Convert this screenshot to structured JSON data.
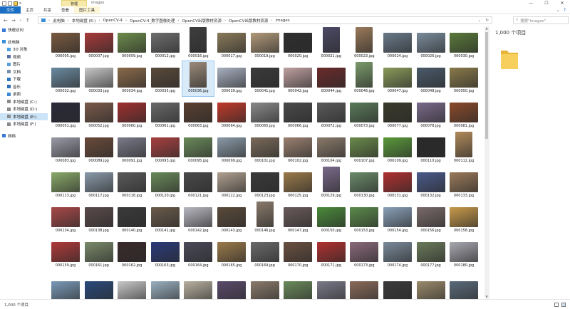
{
  "window": {
    "context_tab": "管理",
    "title": "images",
    "controls": [
      "—",
      "☐",
      "✕"
    ]
  },
  "ribbon": {
    "tabs": [
      "文件",
      "主页",
      "共享",
      "查看",
      "图片工具"
    ]
  },
  "address": {
    "crumbs": [
      "此电脑",
      "本地磁盘 (E:)",
      "OpenCV-4",
      "OpenCV-4_数字图像处理",
      "OpenCV出版教材资源",
      "OpenCV出版教材资源",
      "images"
    ],
    "search_placeholder": "搜索\"images\""
  },
  "nav": {
    "items": [
      {
        "label": "快速访问",
        "level": 1,
        "icon": "star-icon",
        "color": "#3a7bd5"
      },
      {
        "gap": true
      },
      {
        "label": "此电脑",
        "level": 1,
        "icon": "computer-icon",
        "color": "#3a8fd8"
      },
      {
        "label": "3D 对象",
        "level": 2,
        "icon": "cube-icon",
        "color": "#4aa3df"
      },
      {
        "label": "视频",
        "level": 2,
        "icon": "video-icon",
        "color": "#5b6ea8"
      },
      {
        "label": "图片",
        "level": 2,
        "icon": "picture-icon",
        "color": "#5aa0d8"
      },
      {
        "label": "文档",
        "level": 2,
        "icon": "document-icon",
        "color": "#7a8fa8"
      },
      {
        "label": "下载",
        "level": 2,
        "icon": "download-icon",
        "color": "#2f78c4"
      },
      {
        "label": "音乐",
        "level": 2,
        "icon": "music-icon",
        "color": "#2f6fb8"
      },
      {
        "label": "桌面",
        "level": 2,
        "icon": "desktop-icon",
        "color": "#3c8ad6"
      },
      {
        "label": "本地磁盘 (C:)",
        "level": 2,
        "icon": "drive-icon",
        "color": "#8a8a8a"
      },
      {
        "label": "本地磁盘 (D:)",
        "level": 2,
        "icon": "drive-icon",
        "color": "#8a8a8a"
      },
      {
        "label": "本地磁盘 (E:)",
        "level": 2,
        "icon": "drive-icon",
        "color": "#8a8a8a",
        "selected": true
      },
      {
        "label": "本地磁盘 (F:)",
        "level": 2,
        "icon": "drive-icon",
        "color": "#8a8a8a"
      },
      {
        "gap": true
      },
      {
        "label": "网络",
        "level": 1,
        "icon": "network-icon",
        "color": "#3a7bd5"
      }
    ]
  },
  "files": [
    {
      "name": "000005.jpg",
      "color": "#7a5a40"
    },
    {
      "name": "000007.jpg",
      "color": "#a83a3a"
    },
    {
      "name": "000009.jpg",
      "color": "#6c8c4a"
    },
    {
      "name": "000012.jpg",
      "color": "#6e6e6e"
    },
    {
      "name": "000016.jpg",
      "color": "#3e3e3e",
      "tall": true
    },
    {
      "name": "000017.jpg",
      "color": "#8a7a5a"
    },
    {
      "name": "000019.jpg",
      "color": "#b29a7a"
    },
    {
      "name": "000020.jpg",
      "color": "#2e2e2e"
    },
    {
      "name": "000021.jpg",
      "color": "#4c4a66",
      "tall": true
    },
    {
      "name": "000023.jpg",
      "color": "#9a7a5a",
      "tall": true
    },
    {
      "name": "000024.jpg",
      "color": "#6a7a8a"
    },
    {
      "name": "000026.jpg",
      "color": "#7a8c9c"
    },
    {
      "name": "000030.jpg",
      "color": "#5a7a3a"
    },
    {
      "name": "000032.jpg",
      "color": "#6a8aa0"
    },
    {
      "name": "000033.jpg",
      "color": "#c8c8c8"
    },
    {
      "name": "000034.jpg",
      "color": "#8a6a4a"
    },
    {
      "name": "000035.jpg",
      "color": "#5a4a3a"
    },
    {
      "name": "000036.jpg",
      "color": "#9a8a7a",
      "tall": true,
      "selected": true
    },
    {
      "name": "000039.jpg",
      "color": "#a8b0c0"
    },
    {
      "name": "000041.jpg",
      "color": "#3a3a3a"
    },
    {
      "name": "000042.jpg",
      "color": "#c0a0a0"
    },
    {
      "name": "000044.jpg",
      "color": "#6a2a2a"
    },
    {
      "name": "000046.jpg",
      "color": "#7a9a6a",
      "tall": true
    },
    {
      "name": "000047.jpg",
      "color": "#8a9a5a"
    },
    {
      "name": "000048.jpg",
      "color": "#4a5a6a"
    },
    {
      "name": "000050.jpg",
      "color": "#8a7a4a"
    },
    {
      "name": "000051.jpg",
      "color": "#2a2a3a"
    },
    {
      "name": "000052.jpg",
      "color": "#7a5a4a"
    },
    {
      "name": "000060.jpg",
      "color": "#a03030"
    },
    {
      "name": "000061.jpg",
      "color": "#6a6a6a"
    },
    {
      "name": "000063.jpg",
      "color": "#5a4030"
    },
    {
      "name": "000064.jpg",
      "color": "#c03a2a"
    },
    {
      "name": "000065.jpg",
      "color": "#8a8a8a"
    },
    {
      "name": "000066.jpg",
      "color": "#4a4a4a"
    },
    {
      "name": "000072.jpg",
      "color": "#5a5a5a"
    },
    {
      "name": "000073.jpg",
      "color": "#5a7a5a"
    },
    {
      "name": "000077.jpg",
      "color": "#3a3a2a"
    },
    {
      "name": "000078.jpg",
      "color": "#7a6a8a"
    },
    {
      "name": "000081.jpg",
      "color": "#8a4a2a"
    },
    {
      "name": "000083.jpg",
      "color": "#9a9aa8"
    },
    {
      "name": "000089.jpg",
      "color": "#6a4a3a"
    },
    {
      "name": "000091.jpg",
      "color": "#7a7a8a"
    },
    {
      "name": "000093.jpg",
      "color": "#a84040"
    },
    {
      "name": "000095.jpg",
      "color": "#6a8a5a"
    },
    {
      "name": "000099.jpg",
      "color": "#8a9aa8"
    },
    {
      "name": "000101.jpg",
      "color": "#7a6a5a"
    },
    {
      "name": "000102.jpg",
      "color": "#9a8070"
    },
    {
      "name": "000104.jpg",
      "color": "#8a7a6a"
    },
    {
      "name": "000107.jpg",
      "color": "#6a8a4a"
    },
    {
      "name": "000109.jpg",
      "color": "#5a9a3a"
    },
    {
      "name": "000110.jpg",
      "color": "#2a2a2a"
    },
    {
      "name": "000112.jpg",
      "color": "#b08a5a",
      "tall": true
    },
    {
      "name": "000113.jpg",
      "color": "#8aaa6a"
    },
    {
      "name": "000117.jpg",
      "color": "#8a9aaa"
    },
    {
      "name": "000118.jpg",
      "color": "#5a5a5a"
    },
    {
      "name": "000120.jpg",
      "color": "#6a8a5a"
    },
    {
      "name": "000121.jpg",
      "color": "#4a4a4a"
    },
    {
      "name": "000122.jpg",
      "color": "#b0a090"
    },
    {
      "name": "000123.jpg",
      "color": "#3a3a3a"
    },
    {
      "name": "000125.jpg",
      "color": "#9a7a4a"
    },
    {
      "name": "000129.jpg",
      "color": "#7a6a8a",
      "tall": true
    },
    {
      "name": "000130.jpg",
      "color": "#6a8a6a"
    },
    {
      "name": "000131.jpg",
      "color": "#b03030"
    },
    {
      "name": "000132.jpg",
      "color": "#4a5a8a"
    },
    {
      "name": "000133.jpg",
      "color": "#9a7a5a"
    },
    {
      "name": "000134.jpg",
      "color": "#a84848"
    },
    {
      "name": "000138.jpg",
      "color": "#5a4a4a"
    },
    {
      "name": "000140.jpg",
      "color": "#3a3a3a"
    },
    {
      "name": "000141.jpg",
      "color": "#6a5a4a"
    },
    {
      "name": "000142.jpg",
      "color": "#b8b8c0"
    },
    {
      "name": "000143.jpg",
      "color": "#5a4a3a"
    },
    {
      "name": "000146.jpg",
      "color": "#8a7a6a",
      "tall": true
    },
    {
      "name": "000147.jpg",
      "color": "#6a5a5a"
    },
    {
      "name": "000150.jpg",
      "color": "#4a8a3a"
    },
    {
      "name": "000153.jpg",
      "color": "#5a8a4a"
    },
    {
      "name": "000154.jpg",
      "color": "#8aa0b8"
    },
    {
      "name": "000156.jpg",
      "color": "#7a6a6a"
    },
    {
      "name": "000158.jpg",
      "color": "#c89a4a"
    },
    {
      "name": "000159.jpg",
      "color": "#b03a3a"
    },
    {
      "name": "000161.jpg",
      "color": "#7a8a6a"
    },
    {
      "name": "000162.jpg",
      "color": "#3a2a2a"
    },
    {
      "name": "000163.jpg",
      "color": "#2a3a7a"
    },
    {
      "name": "000164.jpg",
      "color": "#4a4a5a"
    },
    {
      "name": "000165.jpg",
      "color": "#9a7a4a"
    },
    {
      "name": "000169.jpg",
      "color": "#6a6a6a"
    },
    {
      "name": "000170.jpg",
      "color": "#6a5040"
    },
    {
      "name": "000171.jpg",
      "color": "#b03030"
    },
    {
      "name": "000173.jpg",
      "color": "#8a6a7a"
    },
    {
      "name": "000174.jpg",
      "color": "#7a8a9a"
    },
    {
      "name": "000177.jpg",
      "color": "#6a7a5a"
    },
    {
      "name": "000180.jpg",
      "color": "#a8a8b0"
    },
    {
      "name": "",
      "color": "#7a9ab8"
    },
    {
      "name": "",
      "color": "#2a4a7a"
    },
    {
      "name": "",
      "color": "#c8c8c8"
    },
    {
      "name": "",
      "color": "#9ab0c0"
    },
    {
      "name": "",
      "color": "#b8b0a0"
    },
    {
      "name": "",
      "color": "#5a4a6a"
    },
    {
      "name": "",
      "color": "#8a7a6a"
    },
    {
      "name": "",
      "color": "#6a8a5a"
    },
    {
      "name": "",
      "color": "#7a7a8a"
    },
    {
      "name": "",
      "color": "#8a6a5a"
    },
    {
      "name": "",
      "color": "#3a3a3a"
    },
    {
      "name": "",
      "color": "#9a8a6a"
    },
    {
      "name": "",
      "color": "#5a6a7a"
    }
  ],
  "preview": {
    "count": "1,000 个项目"
  },
  "status": {
    "text": "1,000 个项目"
  }
}
